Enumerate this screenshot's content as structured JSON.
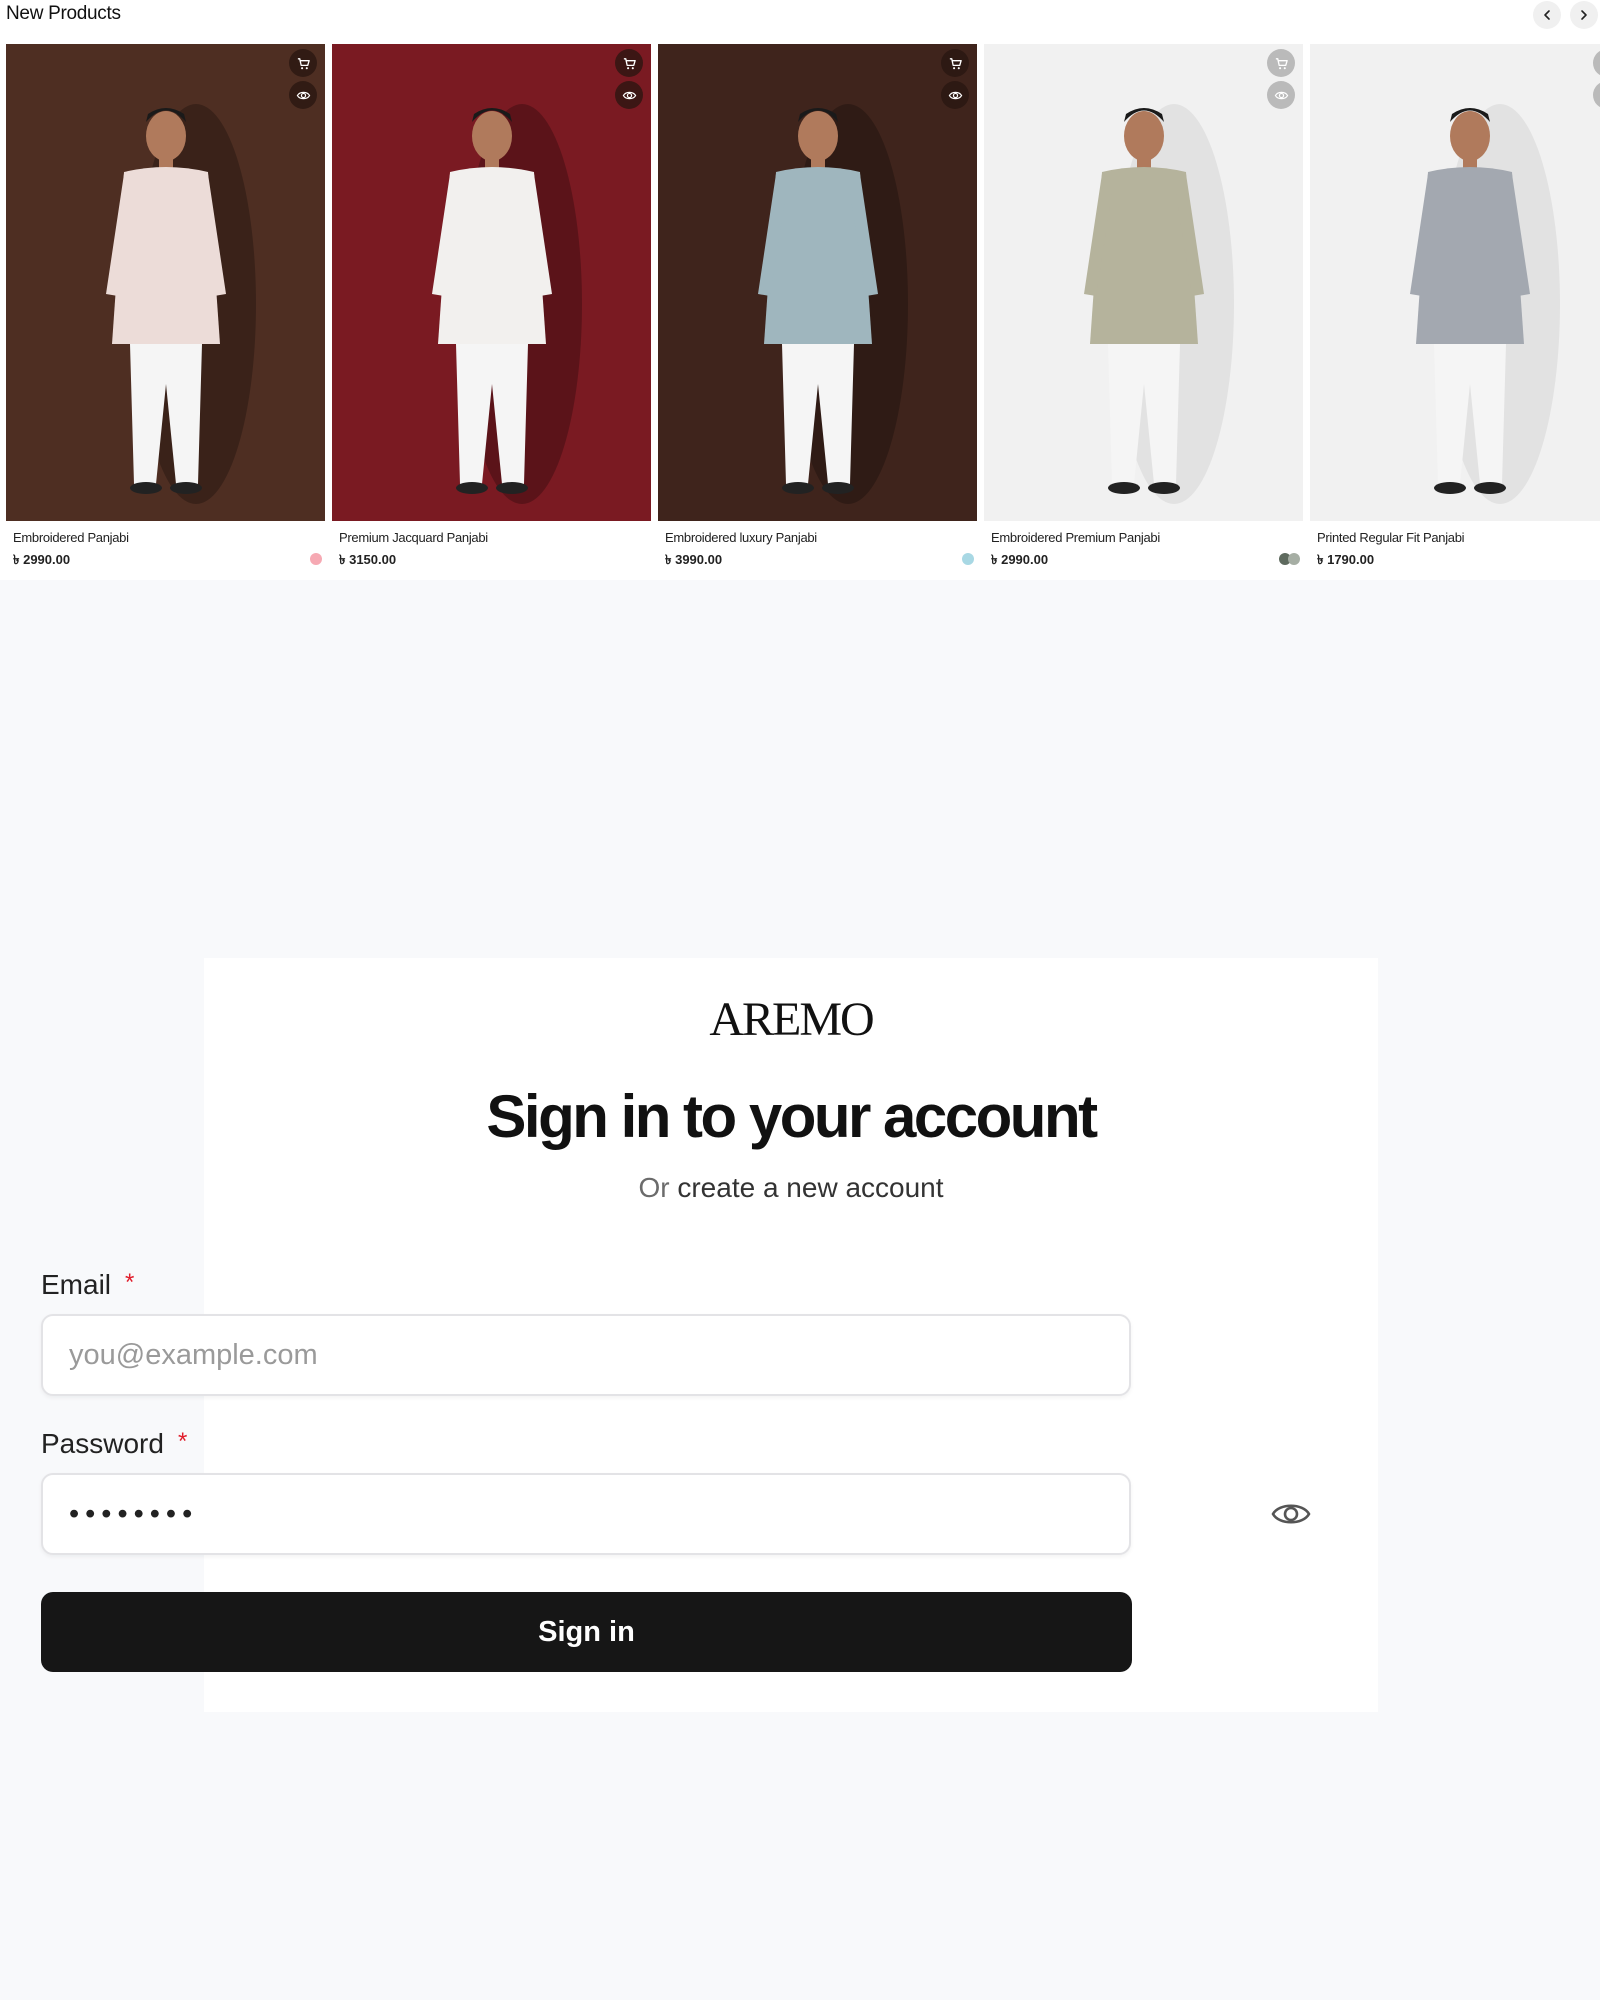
{
  "products_section": {
    "title": "New Products",
    "prev_icon": "chevron-left-icon",
    "next_icon": "chevron-right-icon"
  },
  "products": [
    {
      "name": "Embroidered Panjabi",
      "price": "৳ 2990.00",
      "swatches": [
        "#f6a9b3"
      ],
      "bg": "#4e2e22",
      "kurta": "#ecdcd8"
    },
    {
      "name": "Premium Jacquard Panjabi",
      "price": "৳ 3150.00",
      "swatches": [],
      "bg": "#7a1a22",
      "kurta": "#f2f0ee"
    },
    {
      "name": "Embroidered luxury Panjabi",
      "price": "৳ 3990.00",
      "swatches": [
        "#a8d8e4"
      ],
      "bg": "#3f241c",
      "kurta": "#9fb6be"
    },
    {
      "name": "Embroidered Premium Panjabi",
      "price": "৳ 2990.00",
      "swatches": [
        "#5e6a5e",
        "#a6aea4"
      ],
      "bg": "#f1f1f1",
      "kurta": "#b5b39c"
    },
    {
      "name": "Printed Regular Fit Panjabi",
      "price": "৳ 1790.00",
      "swatches": [
        "#a8d8e4"
      ],
      "bg": "#f1f1f1",
      "kurta": "#a3a8b0"
    }
  ],
  "product_icons": {
    "cart": "cart-icon",
    "view": "eye-icon"
  },
  "signin": {
    "brand": "AREMO",
    "title": "Sign in to your account",
    "subtitle_prefix": "Or ",
    "subtitle_link": "create a new account",
    "email_label": "Email",
    "email_placeholder": "you@example.com",
    "password_label": "Password",
    "password_value": "••••••••",
    "required_mark": "*",
    "button_label": "Sign in"
  }
}
